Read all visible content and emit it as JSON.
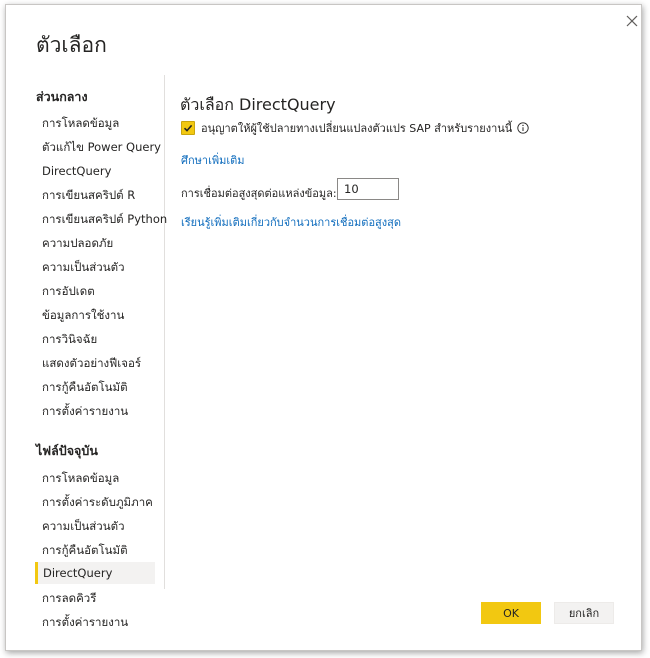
{
  "dialog": {
    "title": "ตัวเลือก",
    "close_icon": "close-icon"
  },
  "sidebar": {
    "global_header": "ส่วนกลาง",
    "global_items": [
      {
        "label": "การโหลดข้อมูล"
      },
      {
        "label": "ตัวแก้ไข Power Query"
      },
      {
        "label": "DirectQuery"
      },
      {
        "label": "การเขียนสคริปต์ R"
      },
      {
        "label": "การเขียนสคริปต์ Python"
      },
      {
        "label": "ความปลอดภัย"
      },
      {
        "label": "ความเป็นส่วนตัว"
      },
      {
        "label": "การอัปเดต"
      },
      {
        "label": "ข้อมูลการใช้งาน"
      },
      {
        "label": "การวินิจฉัย"
      },
      {
        "label": "แสดงตัวอย่างฟีเจอร์"
      },
      {
        "label": "การกู้คืนอัตโนมัติ"
      },
      {
        "label": "การตั้งค่ารายงาน"
      }
    ],
    "current_header": "ไฟล์ปัจจุบัน",
    "current_items": [
      {
        "label": "การโหลดข้อมูล"
      },
      {
        "label": "การตั้งค่าระดับภูมิภาค"
      },
      {
        "label": "ความเป็นส่วนตัว"
      },
      {
        "label": "การกู้คืนอัตโนมัติ"
      },
      {
        "label": "DirectQuery",
        "selected": true
      },
      {
        "label": "การลดคิวรี"
      },
      {
        "label": "การตั้งค่ารายงาน"
      }
    ]
  },
  "content": {
    "title": "ตัวเลือก DirectQuery",
    "checkbox_label": "อนุญาตให้ผู้ใช้ปลายทางเปลี่ยนแปลงตัวแปร SAP สำหรับรายงานนี้",
    "checkbox_checked": true,
    "learn_more": "ศึกษาเพิ่มเติม",
    "max_connections_label": "การเชื่อมต่อสูงสุดต่อแหล่งข้อมูล:",
    "max_connections_value": "10",
    "connections_link": "เรียนรู้เพิ่มเติมเกี่ยวกับจำนวนการเชื่อมต่อสูงสุด"
  },
  "buttons": {
    "ok": "OK",
    "cancel": "ยกเลิก"
  },
  "colors": {
    "accent": "#f2c811",
    "link": "#0f6cbd"
  }
}
